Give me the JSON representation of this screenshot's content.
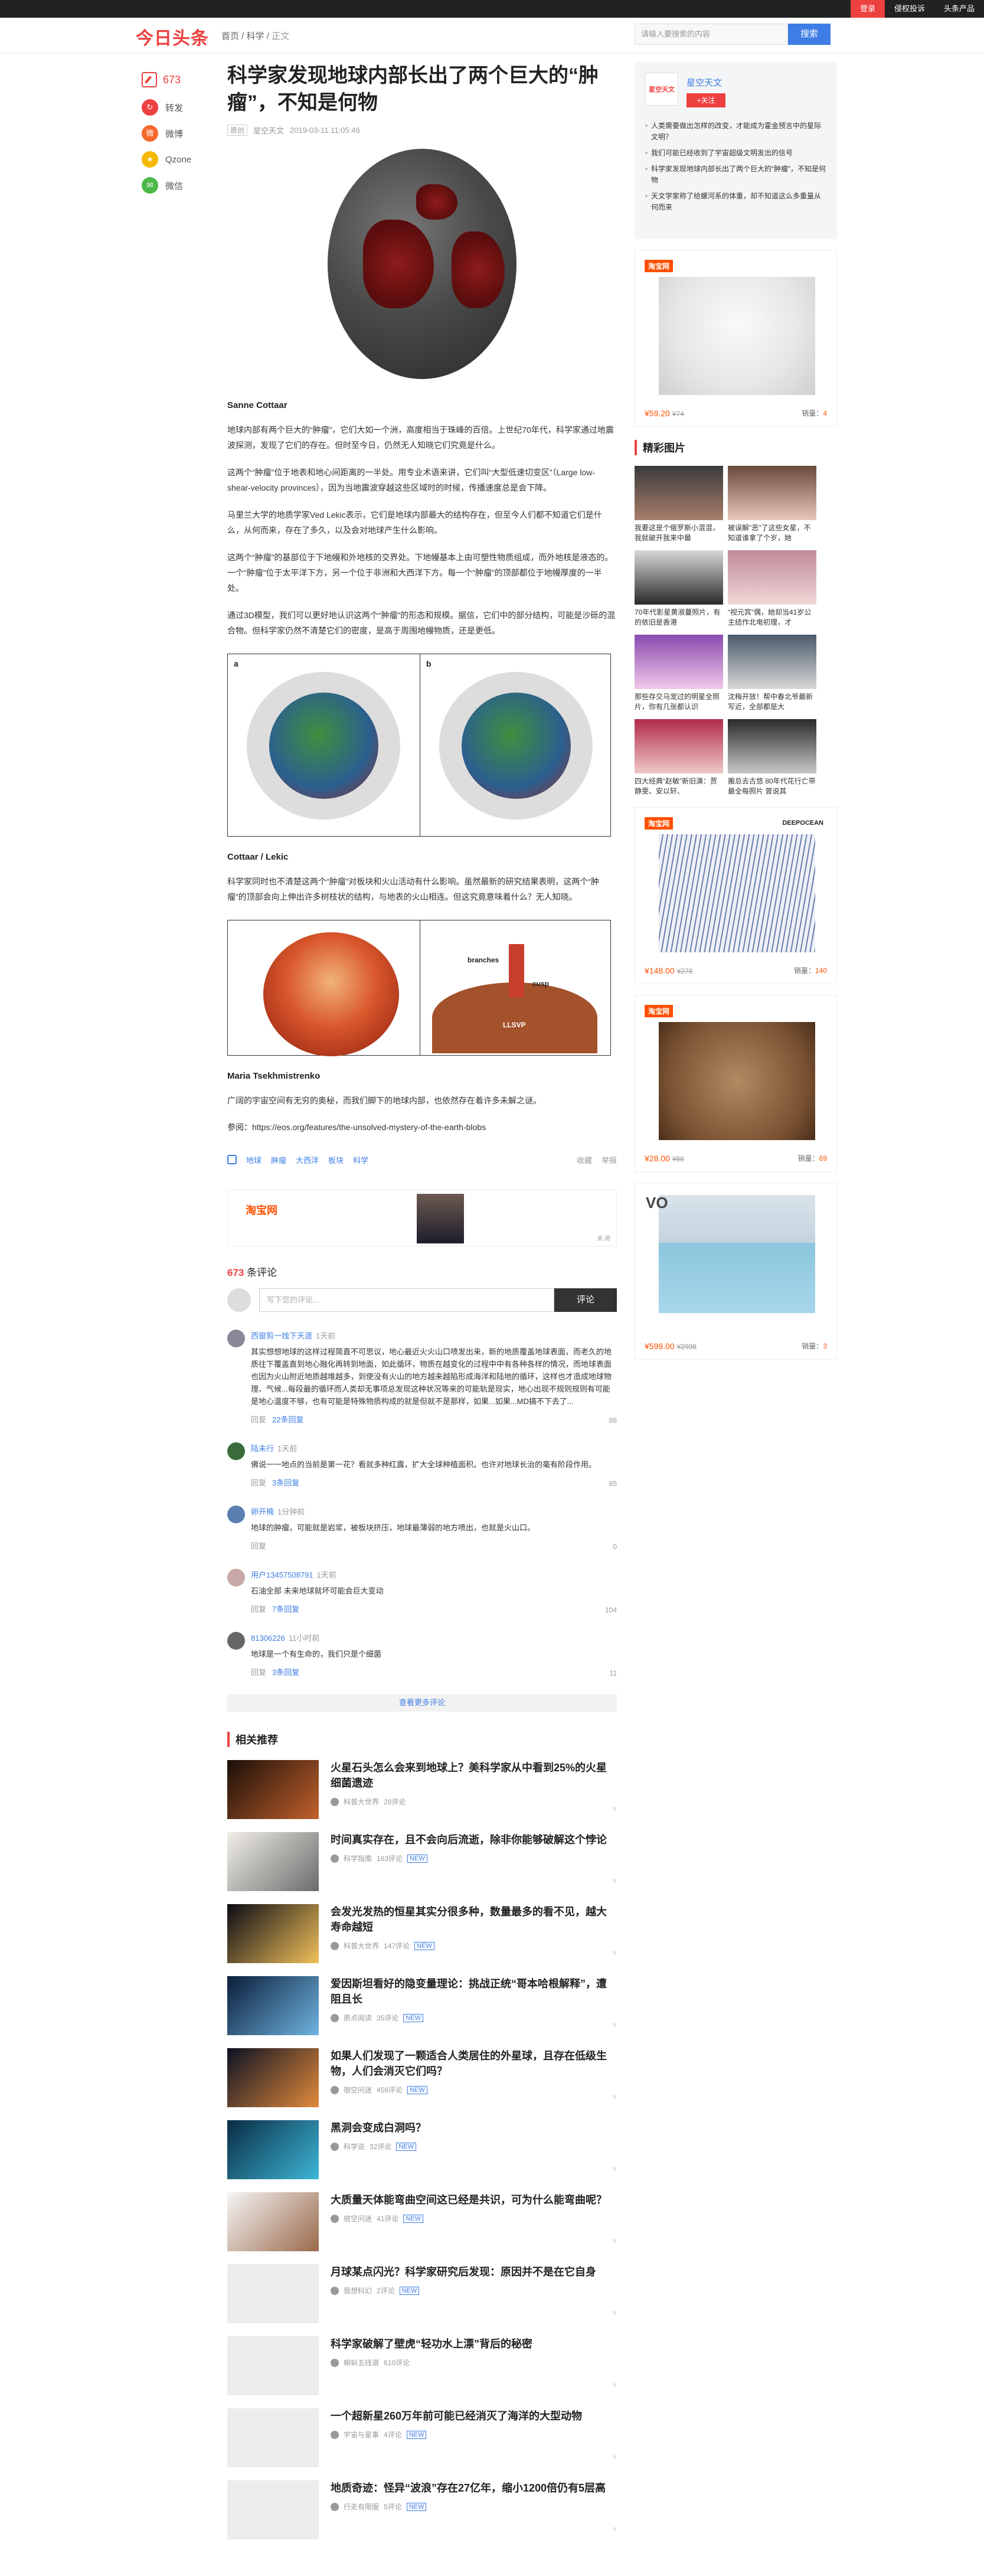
{
  "topbar": {
    "login": "登录",
    "feedback": "侵权投诉",
    "products": "头条产品"
  },
  "header": {
    "logo": "今日头条",
    "breadcrumb_home": "首页",
    "breadcrumb_sep1": " / ",
    "breadcrumb_cat": "科学",
    "breadcrumb_sep2": " / ",
    "breadcrumb_cur": "正文",
    "search_placeholder": "请输入要搜索的内容",
    "search_button": "搜索"
  },
  "share": {
    "count": "673",
    "items": [
      "转发",
      "微博",
      "Qzone",
      "微信"
    ]
  },
  "article": {
    "title": "科学家发现地球内部长出了两个巨大的“肿瘤”，不知是何物",
    "tag": "原创",
    "source": "星空天文",
    "time": "2019-03-11 11:05:46",
    "caption1": "Sanne Cottaar",
    "p1": "地球内部有两个巨大的“肿瘤”，它们大如一个洲，高度相当于珠峰的百倍。上世纪70年代，科学家通过地震波探测，发现了它们的存在。但时至今日，仍然无人知晓它们究竟是什么。",
    "p2": "这两个“肿瘤”位于地表和地心间距离的一半处。用专业术语来讲，它们叫“大型低速切变区”（Large low-shear-velocity provinces），因为当地震波穿越这些区域时的时候，传播速度总是会下降。",
    "p3": "马里兰大学的地质学家Ved Lekic表示，它们是地球内部最大的结构存在，但至今人们都不知道它们是什么，从何而来，存在了多久，以及会对地球产生什么影响。",
    "p4": "这两个“肿瘤”的基部位于下地幔和外地核的交界处。下地幔基本上由可塑性物质组成，而外地核是液态的。一个“肿瘤”位于太平洋下方，另一个位于非洲和大西洋下方。每一个“肿瘤”的顶部都位于地幔厚度的一半处。",
    "p5": "通过3D模型，我们可以更好地认识这两个“肿瘤”的形态和规模。据信，它们中的部分结构，可能是沙砾的混合物。但科学家仍然不清楚它们的密度，是高于周围地幔物质，还是更低。",
    "fig2_a": "a",
    "fig2_b": "b",
    "caption2": "Cottaar / Lekic",
    "p6": "科学家同时也不清楚这两个“肿瘤”对板块和火山活动有什么影响。虽然最新的研究结果表明，这两个“肿瘤”的顶部会向上伸出许多树枝状的结构，与地表的火山相连。但这究竟意味着什么？无人知晓。",
    "fig3_left": "",
    "fig3_branches": "branches",
    "fig3_cusp": "cusp",
    "fig3_llsvp": "LLSVP",
    "caption3": "Maria Tsekhmistrenko",
    "p7": "广阔的宇宙空间有无穷的奥秘，而我们脚下的地球内部，也依然存在着许多未解之谜。",
    "ref": "参阅：https://eos.org/features/the-unsolved-mystery-of-the-earth-blobs",
    "tags": [
      "地球",
      "肿瘤",
      "大西洋",
      "板块",
      "科学"
    ],
    "collect": "收藏",
    "report": "举报"
  },
  "ad_strip": {
    "brand": "淘宝网",
    "close": "关 闭"
  },
  "comments": {
    "count": "673",
    "label": "条评论",
    "placeholder": "写下您的评论...",
    "submit": "评论",
    "items": [
      {
        "user": "西窗剪一烛下天涯",
        "time": "1天前",
        "text": "其实想想地球的这样过程简直不可思议，地心最近火火山口喷发出来，新的地质覆盖地球表面，而老久的地质往下覆盖直到地心融化再转到地面，如此循环，物质在越变化的过程中中有各种各样的情况，而地球表面也因为火山附近地质越堆越多，到使没有火山的地方越来越陷形成海洋和陆地的循环，这样也才造成地球物理、气候...每段最的循环而人类却无事项总发现这种状况等来的可能轨是现实，地心出现不规则规则有可能是地心温度不够，也有可能是特殊物质构成的就是但就不是那样，如果...如果...MD搞不下去了...",
        "replies": "22条回复",
        "likes": "86"
      },
      {
        "user": "陆未行",
        "time": "1天前",
        "text": "佛说一一地点的当前是第一花？看就多种红露，扩大全球种植面积。也许对地球长治的毫有阶段作用。",
        "replies": "3条回复",
        "likes": "85"
      },
      {
        "user": "卵开楠",
        "time": "1分钟前",
        "text": "地球的肿瘤，可能就是岩浆，被板块挤压，地球最薄弱的地方喷出，也就是火山口。",
        "replies": "",
        "likes": "0"
      },
      {
        "user": "用户13457508791",
        "time": "1天前",
        "text": "石油全部 未来地球就坏可能会巨大变动",
        "replies": "7条回复",
        "likes": "104"
      },
      {
        "user": "81306226",
        "time": "11小时前",
        "text": "地球是一个有生命的，我们只是个细菌",
        "replies": "3条回复",
        "likes": "11"
      }
    ],
    "reply_label": "回复",
    "more": "查看更多评论"
  },
  "recommend": {
    "heading": "相关推荐",
    "items": [
      {
        "title": "火星石头怎么会来到地球上？美科学家从中看到25%的火星细菌遗迹",
        "source": "科普大世界",
        "count": "28评论",
        "new": false
      },
      {
        "title": "时间真实存在，且不会向后流逝，除非你能够破解这个悖论",
        "source": "科学指南",
        "count": "163评论",
        "new": true
      },
      {
        "title": "会发光发热的恒星其实分很多种，数量最多的看不见，越大寿命越短",
        "source": "科普大世界",
        "count": "147评论",
        "new": true
      },
      {
        "title": "爱因斯坦看好的隐变量理论：挑战正统“哥本哈根解释”，遭阻且长",
        "source": "原点阅读",
        "count": "35评论",
        "new": true
      },
      {
        "title": "如果人们发现了一颗适合人类居住的外星球，且存在低级生物，人们会消灭它们吗？",
        "source": "宿空问迷",
        "count": "456评论",
        "new": true
      },
      {
        "title": "黑洞会变成白洞吗？",
        "source": "科学说",
        "count": "32评论",
        "new": true
      },
      {
        "title": "大质量天体能弯曲空间这已经是共识，可为什么能弯曲呢？",
        "source": "宿空问迷",
        "count": "41评论",
        "new": true
      },
      {
        "title": "月球某点闪光？科学家研究后发现：原因并不是在它自身",
        "source": "我想科幻",
        "count": "2评论",
        "new": true
      },
      {
        "title": "科学家破解了壁虎“轻功水上漂”背后的秘密",
        "source": "蝌蚪五线谱",
        "count": "610评论",
        "new": false
      },
      {
        "title": "一个超新星260万年前可能已经消灭了海洋的大型动物",
        "source": "宇宙与星事",
        "count": "4评论",
        "new": true
      },
      {
        "title": "地质奇迹：怪异“波浪”存在27亿年，缩小1200倍仍有5层高",
        "source": "行走有限服",
        "count": "5评论",
        "new": true
      }
    ],
    "new_label": "NEW"
  },
  "sidebar": {
    "author_logo": "星空天文",
    "author_name": "星空天文",
    "follow": "+关注",
    "links": [
      "人类需要做出怎样的改变，才能成为霍金预言中的星际文明？",
      "我们可能已经收到了宇宙超级文明发出的信号",
      "科学家发现地球内部长出了两个巨大的“肿瘤”，不知是何物",
      "天文学家称了给螺河系的体重，却不知道这么多重量从何而来"
    ],
    "ads": [
      {
        "brand": "淘宝网",
        "price": "¥59.20",
        "old": "¥74",
        "sold_label": "销量：",
        "sold": "4"
      },
      {
        "brand": "淘宝网",
        "price": "¥148.00",
        "old": "¥278",
        "sold_label": "销量：",
        "sold": "140",
        "logo": "DEEPOCEAN"
      },
      {
        "brand": "淘宝网",
        "price": "¥28.00",
        "old": "¥88",
        "sold_label": "销量：",
        "sold": "69"
      },
      {
        "brand": "淘宝网",
        "price": "¥599.00",
        "old": "¥2998",
        "sold_label": "销量：",
        "sold": "3",
        "logo": "VO"
      }
    ],
    "gallery_heading": "精彩图片",
    "gallery": [
      "我要这是个俄罗斯小混混，我就破开我来中最",
      "被误解\"恶\"了这些女星，不知道谁拿了个岁，她",
      "70年代影星黄淑蔓照片，有的依旧是香港",
      "“视元宾”偶，她却当41岁公主结作北电初理，才",
      "那些存交马宠过的明星全照片，你有几张都认识",
      "沈梅开放！帮中春北爷最新写近，全部都是大",
      "四大经典“赵敏”新旧演：贾静雯、安以轩、",
      "搬总去古悠 80年代花行亡带最全每照片 曾说其"
    ]
  }
}
